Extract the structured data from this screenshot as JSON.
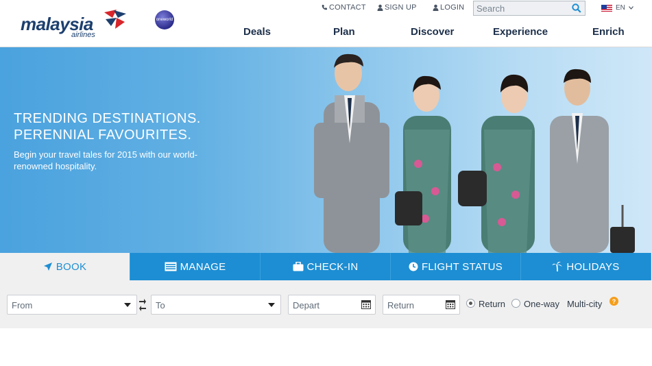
{
  "brand": {
    "logo_word": "malaysia",
    "logo_sub": "airlines",
    "partner_logo_text": "oneworld"
  },
  "top_links": {
    "contact": "CONTACT",
    "signup": "SIGN UP",
    "login": "LOGIN"
  },
  "search": {
    "placeholder": "Search"
  },
  "language": {
    "label": "EN"
  },
  "nav": {
    "items": [
      "Deals",
      "Plan",
      "Discover",
      "Experience",
      "Enrich"
    ]
  },
  "hero": {
    "title_line1": "TRENDING DESTINATIONS.",
    "title_line2": "PERENNIAL FAVOURITES.",
    "subtitle": "Begin your travel tales for 2015 with our world-renowned hospitality."
  },
  "tabs": [
    {
      "label": "BOOK",
      "icon": "plane-icon",
      "active": true
    },
    {
      "label": "MANAGE",
      "icon": "list-icon",
      "active": false
    },
    {
      "label": "CHECK-IN",
      "icon": "briefcase-icon",
      "active": false
    },
    {
      "label": "FLIGHT STATUS",
      "icon": "clock-icon",
      "active": false
    },
    {
      "label": "HOLIDAYS",
      "icon": "palm-tree-icon",
      "active": false
    }
  ],
  "booking": {
    "from_placeholder": "From",
    "to_placeholder": "To",
    "depart_placeholder": "Depart",
    "return_placeholder": "Return",
    "trip_types": [
      {
        "label": "Return",
        "selected": true
      },
      {
        "label": "One-way",
        "selected": false
      },
      {
        "label": "Multi-city",
        "selected": false
      }
    ],
    "help_symbol": "?"
  },
  "colors": {
    "brand_navy": "#1c3f6e",
    "tab_blue": "#1d8ed3",
    "accent_red": "#d7262b",
    "help_orange": "#f59e1b"
  }
}
